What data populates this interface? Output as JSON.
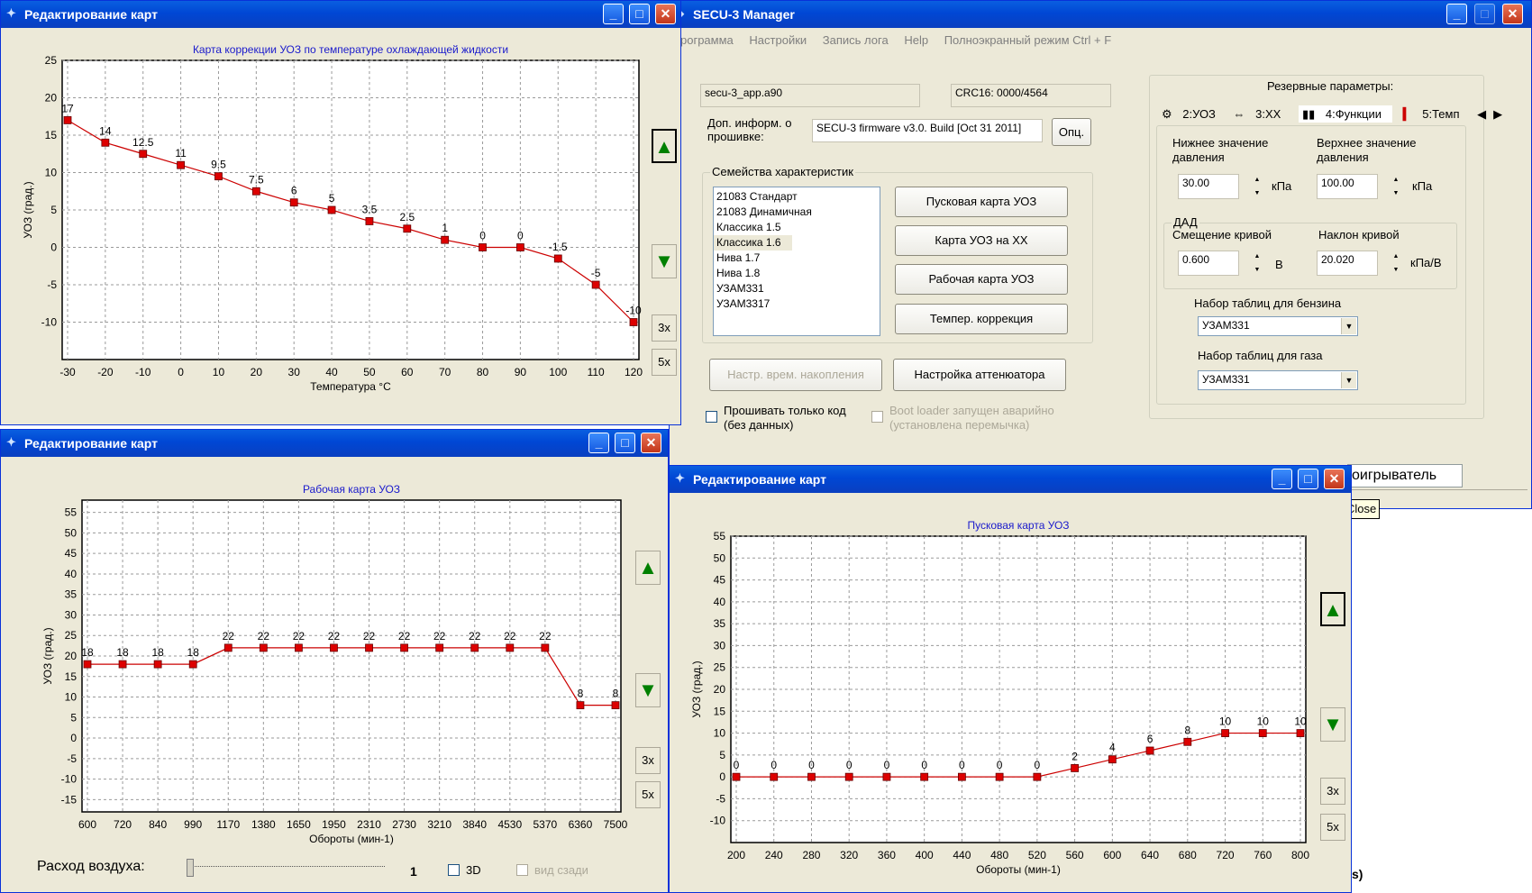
{
  "secu": {
    "title": "SECU-3 Manager",
    "menu": [
      "рограмма",
      "Настройки",
      "Запись лога",
      "Help",
      "Полноэкранный режим Ctrl + F"
    ],
    "file_name": "secu-3_app.a90",
    "crc": "CRC16: 0000/4564",
    "info_label": "Доп. информ. о прошивке:",
    "firmware_info": "SECU-3 firmware v3.0. Build [Oct 31 2011]",
    "options_button": "Опц.",
    "families_label": "Семейства характеристик",
    "families": [
      "21083 Стандарт",
      "21083 Динамичная",
      "Классика 1.5",
      "Классика 1.6",
      "Нива 1.7",
      "Нива 1.8",
      "УЗАМ331",
      "УЗАМ3317"
    ],
    "families_selected": "Классика 1.6",
    "map_buttons": [
      "Пусковая карта УОЗ",
      "Карта УОЗ на ХХ",
      "Рабочая карта УОЗ",
      "Темпер. коррекция"
    ],
    "accum_button": "Настр. врем. накопления",
    "attenuator_button": "Настройка аттенюатора",
    "flash_code_only": "Прошивать только код (без данных)",
    "bootloader_emergency": "Boot loader запущен аварийно (установлена перемычка)",
    "reserve_label": "Резервные параметры:",
    "tabs": [
      "2:УОЗ",
      "3:ХХ",
      "4:Функции",
      "5:Темп"
    ],
    "lower_pressure_label": "Нижнее значение давления",
    "lower_pressure": "30.00",
    "upper_pressure_label": "Верхнее значение давления",
    "upper_pressure": "100.00",
    "pressure_unit": "кПа",
    "dad_label": "ДАД",
    "curve_offset_label": "Смещение кривой",
    "curve_offset": "0.600",
    "curve_offset_unit": "В",
    "curve_slope_label": "Наклон кривой",
    "curve_slope": "20.020",
    "curve_slope_unit": "кПа/В",
    "petrol_tables_label": "Набор таблиц для бензина",
    "petrol_tables": "УЗАМ331",
    "gas_tables_label": "Набор таблиц для газа",
    "gas_tables": "УЗАМ331",
    "player_tab": "оигрыватель",
    "tooltip_close": "Close",
    "bottom_fragment": "s)"
  },
  "editor_title": "Редактирование карт",
  "buttons_3x": "3x",
  "buttons_5x": "5x",
  "air_flow_label": "Расход воздуха:",
  "air_flow_value": "1",
  "check_3d": "3D",
  "check_rear_view": "вид сзади",
  "chart_data": [
    {
      "type": "line",
      "title": "Карта коррекции УОЗ по температуре охлаждающей жидкости",
      "xlabel": "Температура °C",
      "ylabel": "УОЗ (град.)",
      "categories": [
        "-30",
        "-20",
        "-10",
        "0",
        "10",
        "20",
        "30",
        "40",
        "50",
        "60",
        "70",
        "80",
        "90",
        "100",
        "110",
        "120"
      ],
      "values": [
        17,
        14,
        12.5,
        11,
        9.5,
        7.5,
        6,
        5,
        3.5,
        2.5,
        1,
        0,
        0,
        -1.5,
        -5,
        -10
      ],
      "labels": [
        "17",
        "14",
        "12.5",
        "11",
        "9.5",
        "7.5",
        "6",
        "5",
        "3.5",
        "2.5",
        "1",
        "0",
        "0",
        "-1.5",
        "-5",
        "-10"
      ],
      "yticks": [
        25,
        20,
        15,
        10,
        5,
        0,
        -5,
        -10
      ],
      "ylim": [
        -15,
        25
      ],
      "color": "#cc0000",
      "grid": true
    },
    {
      "type": "line",
      "title": "Рабочая карта УОЗ",
      "xlabel": "Обороты (мин-1)",
      "ylabel": "УОЗ (град.)",
      "categories": [
        "600",
        "720",
        "840",
        "990",
        "1170",
        "1380",
        "1650",
        "1950",
        "2310",
        "2730",
        "3210",
        "3840",
        "4530",
        "5370",
        "6360",
        "7500"
      ],
      "values": [
        18,
        18,
        18,
        18,
        22,
        22,
        22,
        22,
        22,
        22,
        22,
        22,
        22,
        22,
        8,
        8
      ],
      "labels": [
        "18",
        "18",
        "18",
        "18",
        "22",
        "22",
        "22",
        "22",
        "22",
        "22",
        "22",
        "22",
        "22",
        "22",
        "8",
        "8"
      ],
      "yticks": [
        55,
        50,
        45,
        40,
        35,
        30,
        25,
        20,
        15,
        10,
        5,
        0,
        -5,
        -10,
        -15
      ],
      "ylim": [
        -18,
        58
      ],
      "color": "#cc0000",
      "grid": true
    },
    {
      "type": "line",
      "title": "Пусковая карта УОЗ",
      "xlabel": "Обороты (мин-1)",
      "ylabel": "УОЗ (град.)",
      "categories": [
        "200",
        "240",
        "280",
        "320",
        "360",
        "400",
        "440",
        "480",
        "520",
        "560",
        "600",
        "640",
        "680",
        "720",
        "760",
        "800"
      ],
      "values": [
        0,
        0,
        0,
        0,
        0,
        0,
        0,
        0,
        0,
        2,
        4,
        6,
        8,
        10,
        10,
        10
      ],
      "labels": [
        "0",
        "0",
        "0",
        "0",
        "0",
        "0",
        "0",
        "0",
        "0",
        "2",
        "4",
        "6",
        "8",
        "10",
        "10",
        "10"
      ],
      "yticks": [
        55,
        50,
        45,
        40,
        35,
        30,
        25,
        20,
        15,
        10,
        5,
        0,
        -5,
        -10
      ],
      "ylim": [
        -15,
        55
      ],
      "color": "#cc0000",
      "grid": true
    }
  ]
}
